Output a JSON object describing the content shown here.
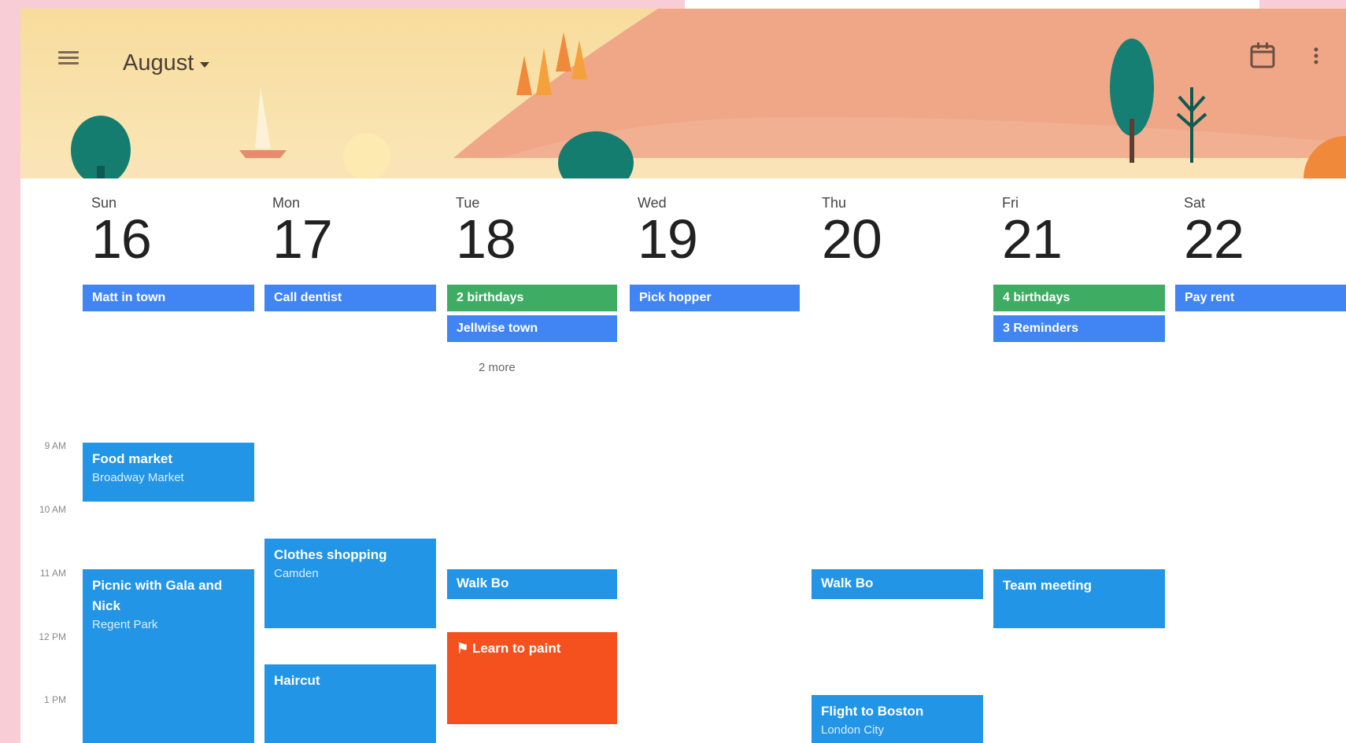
{
  "header": {
    "month_label": "August",
    "icons": {
      "menu": "hamburger-icon",
      "caret": "chevron-down-icon",
      "today": "calendar-today-icon",
      "more": "more-vert-icon"
    }
  },
  "days": [
    {
      "name": "Sun",
      "number": "16"
    },
    {
      "name": "Mon",
      "number": "17"
    },
    {
      "name": "Tue",
      "number": "18"
    },
    {
      "name": "Wed",
      "number": "19"
    },
    {
      "name": "Thu",
      "number": "20"
    },
    {
      "name": "Fri",
      "number": "21"
    },
    {
      "name": "Sat",
      "number": "22"
    }
  ],
  "all_day": {
    "sun": "Matt in town",
    "mon": "Call dentist",
    "tue_1": "2 birthdays",
    "tue_2": "Jellwise town",
    "tue_more": "2 more",
    "wed": "Pick hopper",
    "fri_1": "4 birthdays",
    "fri_2": "3 Reminders",
    "sat": "Pay rent"
  },
  "times": [
    "9 AM",
    "10 AM",
    "11 AM",
    "12 PM",
    "1 PM"
  ],
  "events": {
    "food_market": {
      "title": "Food market",
      "subtitle": "Broadway Market"
    },
    "picnic": {
      "title": "Picnic with Gala and Nick",
      "subtitle": "Regent Park"
    },
    "clothes": {
      "title": "Clothes shopping",
      "subtitle": "Camden"
    },
    "haircut": {
      "title": "Haircut"
    },
    "walk_tue": {
      "title": "Walk Bo"
    },
    "learn_paint": {
      "title": "Learn to paint"
    },
    "walk_thu": {
      "title": "Walk Bo"
    },
    "flight": {
      "title": "Flight to Boston",
      "subtitle": "London City"
    },
    "team_meeting": {
      "title": "Team meeting"
    }
  },
  "colors": {
    "event_blue": "#2295e6",
    "chip_blue": "#4185f4",
    "chip_green": "#3fac64",
    "event_orange": "#f4511e",
    "background_pink": "#f9cdd6"
  }
}
